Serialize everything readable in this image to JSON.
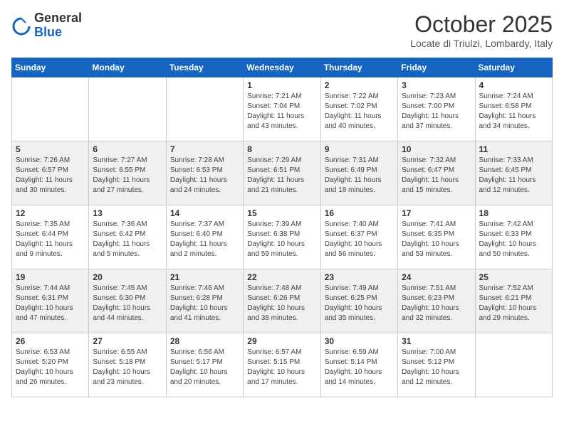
{
  "logo": {
    "general": "General",
    "blue": "Blue"
  },
  "title": "October 2025",
  "subtitle": "Locate di Triulzi, Lombardy, Italy",
  "weekdays": [
    "Sunday",
    "Monday",
    "Tuesday",
    "Wednesday",
    "Thursday",
    "Friday",
    "Saturday"
  ],
  "weeks": [
    [
      {
        "day": "",
        "info": ""
      },
      {
        "day": "",
        "info": ""
      },
      {
        "day": "",
        "info": ""
      },
      {
        "day": "1",
        "info": "Sunrise: 7:21 AM\nSunset: 7:04 PM\nDaylight: 11 hours\nand 43 minutes."
      },
      {
        "day": "2",
        "info": "Sunrise: 7:22 AM\nSunset: 7:02 PM\nDaylight: 11 hours\nand 40 minutes."
      },
      {
        "day": "3",
        "info": "Sunrise: 7:23 AM\nSunset: 7:00 PM\nDaylight: 11 hours\nand 37 minutes."
      },
      {
        "day": "4",
        "info": "Sunrise: 7:24 AM\nSunset: 6:58 PM\nDaylight: 11 hours\nand 34 minutes."
      }
    ],
    [
      {
        "day": "5",
        "info": "Sunrise: 7:26 AM\nSunset: 6:57 PM\nDaylight: 11 hours\nand 30 minutes."
      },
      {
        "day": "6",
        "info": "Sunrise: 7:27 AM\nSunset: 6:55 PM\nDaylight: 11 hours\nand 27 minutes."
      },
      {
        "day": "7",
        "info": "Sunrise: 7:28 AM\nSunset: 6:53 PM\nDaylight: 11 hours\nand 24 minutes."
      },
      {
        "day": "8",
        "info": "Sunrise: 7:29 AM\nSunset: 6:51 PM\nDaylight: 11 hours\nand 21 minutes."
      },
      {
        "day": "9",
        "info": "Sunrise: 7:31 AM\nSunset: 6:49 PM\nDaylight: 11 hours\nand 18 minutes."
      },
      {
        "day": "10",
        "info": "Sunrise: 7:32 AM\nSunset: 6:47 PM\nDaylight: 11 hours\nand 15 minutes."
      },
      {
        "day": "11",
        "info": "Sunrise: 7:33 AM\nSunset: 6:45 PM\nDaylight: 11 hours\nand 12 minutes."
      }
    ],
    [
      {
        "day": "12",
        "info": "Sunrise: 7:35 AM\nSunset: 6:44 PM\nDaylight: 11 hours\nand 9 minutes."
      },
      {
        "day": "13",
        "info": "Sunrise: 7:36 AM\nSunset: 6:42 PM\nDaylight: 11 hours\nand 5 minutes."
      },
      {
        "day": "14",
        "info": "Sunrise: 7:37 AM\nSunset: 6:40 PM\nDaylight: 11 hours\nand 2 minutes."
      },
      {
        "day": "15",
        "info": "Sunrise: 7:39 AM\nSunset: 6:38 PM\nDaylight: 10 hours\nand 59 minutes."
      },
      {
        "day": "16",
        "info": "Sunrise: 7:40 AM\nSunset: 6:37 PM\nDaylight: 10 hours\nand 56 minutes."
      },
      {
        "day": "17",
        "info": "Sunrise: 7:41 AM\nSunset: 6:35 PM\nDaylight: 10 hours\nand 53 minutes."
      },
      {
        "day": "18",
        "info": "Sunrise: 7:42 AM\nSunset: 6:33 PM\nDaylight: 10 hours\nand 50 minutes."
      }
    ],
    [
      {
        "day": "19",
        "info": "Sunrise: 7:44 AM\nSunset: 6:31 PM\nDaylight: 10 hours\nand 47 minutes."
      },
      {
        "day": "20",
        "info": "Sunrise: 7:45 AM\nSunset: 6:30 PM\nDaylight: 10 hours\nand 44 minutes."
      },
      {
        "day": "21",
        "info": "Sunrise: 7:46 AM\nSunset: 6:28 PM\nDaylight: 10 hours\nand 41 minutes."
      },
      {
        "day": "22",
        "info": "Sunrise: 7:48 AM\nSunset: 6:26 PM\nDaylight: 10 hours\nand 38 minutes."
      },
      {
        "day": "23",
        "info": "Sunrise: 7:49 AM\nSunset: 6:25 PM\nDaylight: 10 hours\nand 35 minutes."
      },
      {
        "day": "24",
        "info": "Sunrise: 7:51 AM\nSunset: 6:23 PM\nDaylight: 10 hours\nand 32 minutes."
      },
      {
        "day": "25",
        "info": "Sunrise: 7:52 AM\nSunset: 6:21 PM\nDaylight: 10 hours\nand 29 minutes."
      }
    ],
    [
      {
        "day": "26",
        "info": "Sunrise: 6:53 AM\nSunset: 5:20 PM\nDaylight: 10 hours\nand 26 minutes."
      },
      {
        "day": "27",
        "info": "Sunrise: 6:55 AM\nSunset: 5:18 PM\nDaylight: 10 hours\nand 23 minutes."
      },
      {
        "day": "28",
        "info": "Sunrise: 6:56 AM\nSunset: 5:17 PM\nDaylight: 10 hours\nand 20 minutes."
      },
      {
        "day": "29",
        "info": "Sunrise: 6:57 AM\nSunset: 5:15 PM\nDaylight: 10 hours\nand 17 minutes."
      },
      {
        "day": "30",
        "info": "Sunrise: 6:59 AM\nSunset: 5:14 PM\nDaylight: 10 hours\nand 14 minutes."
      },
      {
        "day": "31",
        "info": "Sunrise: 7:00 AM\nSunset: 5:12 PM\nDaylight: 10 hours\nand 12 minutes."
      },
      {
        "day": "",
        "info": ""
      }
    ]
  ]
}
